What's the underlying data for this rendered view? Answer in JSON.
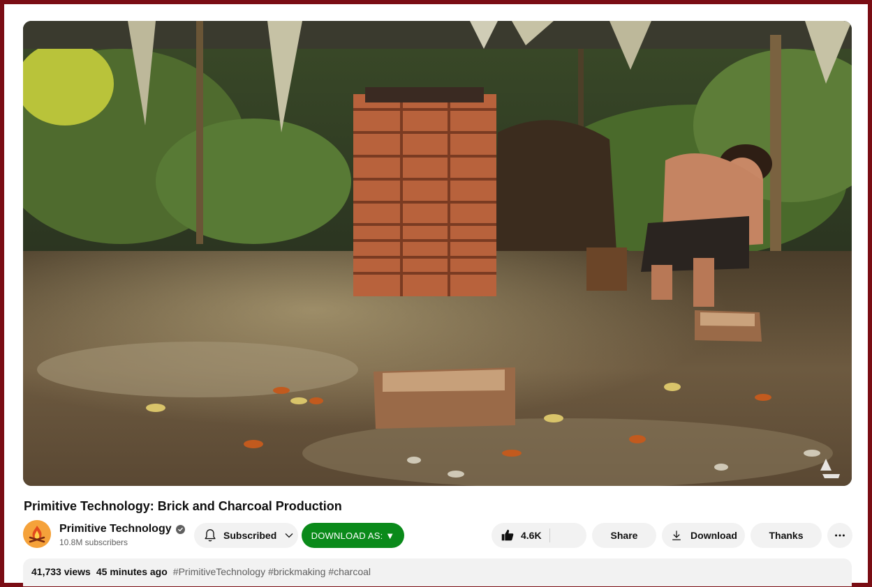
{
  "video": {
    "title": "Primitive Technology: Brick and Charcoal Production",
    "watermark_icon": "primitive-technology-watermark-icon"
  },
  "channel": {
    "name": "Primitive Technology",
    "subscribers": "10.8M subscribers",
    "verified_icon": "verified-check-icon",
    "avatar_icon": "campfire-logo-icon"
  },
  "actions": {
    "subscribed_label": "Subscribed",
    "download_as_label": "DOWNLOAD AS: ▼",
    "like_count": "4.6K",
    "share_label": "Share",
    "download_label": "Download",
    "thanks_label": "Thanks",
    "more_icon": "more-horizontal-icon"
  },
  "description": {
    "views": "41,733 views",
    "time_ago": "45 minutes ago",
    "hashtags": "#PrimitiveTechnology #brickmaking #charcoal"
  },
  "colors": {
    "frame_border": "#7a0d14",
    "download_as_bg": "#0a8a1a",
    "pill_bg": "#f2f2f2",
    "secondary_text": "#606060"
  }
}
